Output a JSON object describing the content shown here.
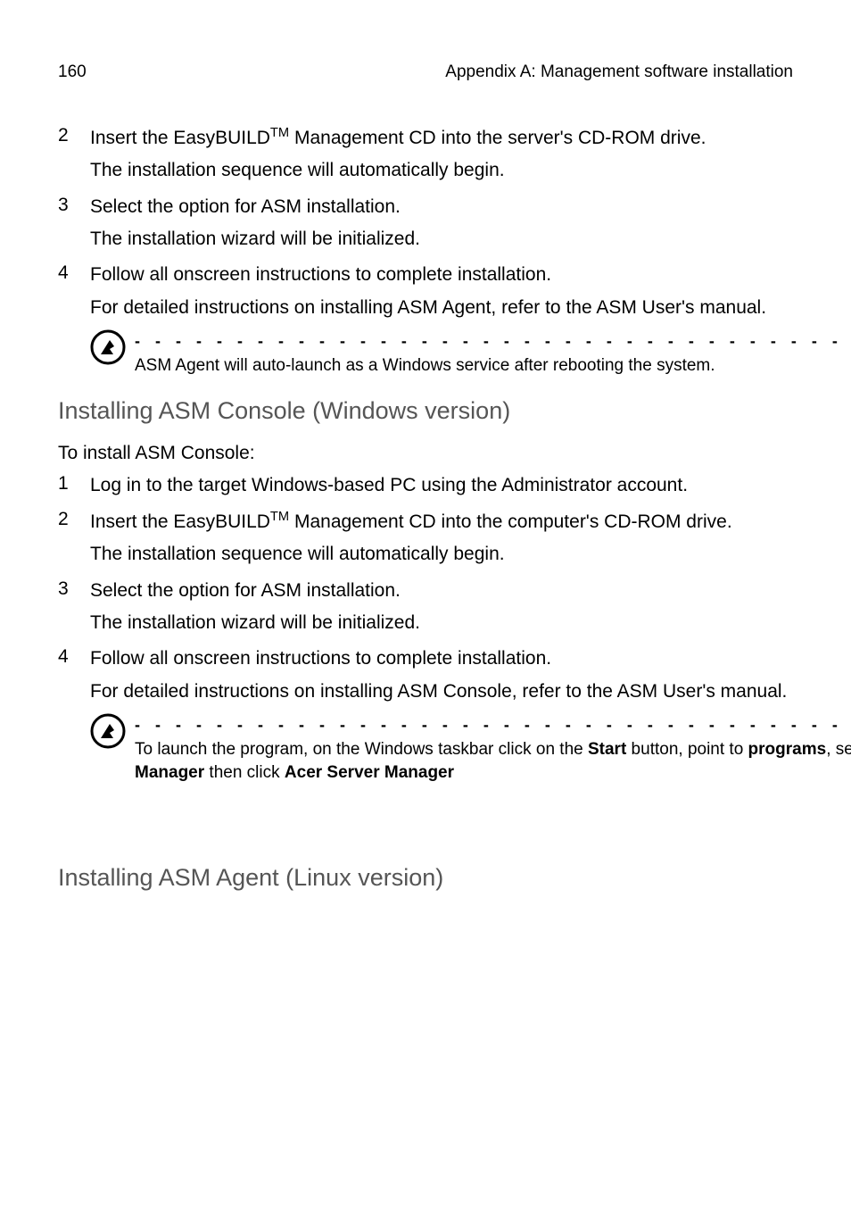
{
  "header": {
    "page_num": "160",
    "title": "Appendix A: Management software installation"
  },
  "steps_a": [
    {
      "num": "2",
      "text": "Insert the EasyBUILD™ Management CD into the server's CD-ROM drive.",
      "sub": "The installation sequence will automatically begin."
    },
    {
      "num": "3",
      "text": "Select the option for ASM installation.",
      "sub": "The installation wizard will be initialized."
    },
    {
      "num": "4",
      "text": "Follow all onscreen instructions to complete installation.",
      "sub": "For detailed instructions on installing ASM Agent, refer to the ASM User's manual."
    }
  ],
  "note_a": "ASM Agent will auto-launch as a Windows service after rebooting the system.",
  "section_b_title": "Installing ASM Console (Windows version)",
  "section_b_intro": "To install ASM Console:",
  "steps_b": [
    {
      "num": "1",
      "text": "Log in to the target Windows-based PC using the Administrator account.",
      "sub": null
    },
    {
      "num": "2",
      "text": "Insert the EasyBUILD™ Management CD into the computer's CD-ROM drive.",
      "sub": "The installation sequence will automatically begin."
    },
    {
      "num": "3",
      "text": "Select the option for ASM installation.",
      "sub": "The installation wizard will be initialized."
    },
    {
      "num": "4",
      "text": "Follow all onscreen instructions to complete installation.",
      "sub": "For detailed instructions on installing ASM Console, refer to the ASM User's manual."
    }
  ],
  "note_b": {
    "t1": "To launch the program, on the Windows taskbar click on the ",
    "b1": "Start",
    "t2": " button, point to ",
    "b2": "programs",
    "t3": ", select ",
    "b3": "Acer Server Manager",
    "t4": " then click ",
    "b4": "Acer Server Manager"
  },
  "section_c_title": "Installing ASM Agent (Linux version)",
  "dashline": "- - - - - - - - - - - - - - - - - - - - - - - - - - - - - - - - - - - - - - - - - - - -"
}
